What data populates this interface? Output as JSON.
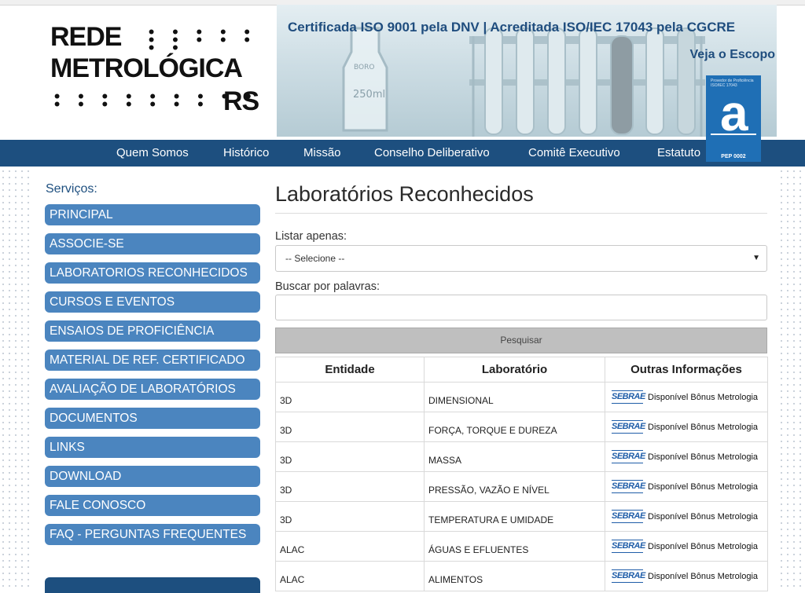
{
  "logo": {
    "line1": "REDE",
    "line2": "METROLÓGICA",
    "line3": "RS",
    "dots1": "• • • • • • • • • • • •",
    "dots2": "• • • • • • • • • • • • • • • •"
  },
  "banner": {
    "certification": "Certificada ISO 9001 pela DNV | Acreditada ISO/IEC 17043 pela CGCRE",
    "scope_link": "Veja o Escopo",
    "badge_small_text": "Provedor de Proficiência ISO/IEC 17043",
    "badge_letter": "a",
    "badge_code": "PEP 0002"
  },
  "nav": [
    "Quem Somos",
    "Histórico",
    "Missão",
    "Conselho Deliberativo",
    "Comitê Executivo",
    "Estatuto"
  ],
  "sidebar": {
    "title": "Serviços:",
    "items": [
      "PRINCIPAL",
      "ASSOCIE-SE",
      "LABORATORIOS RECONHECIDOS",
      "CURSOS E EVENTOS",
      "ENSAIOS DE PROFICIÊNCIA",
      "MATERIAL DE REF. CERTIFICADO",
      "AVALIAÇÃO DE LABORATÓRIOS",
      "DOCUMENTOS",
      "LINKS",
      "DOWNLOAD",
      "FALE CONOSCO",
      "FAQ - PERGUNTAS FREQUENTES"
    ]
  },
  "main": {
    "title": "Laboratórios Reconhecidos",
    "filter_label": "Listar apenas:",
    "filter_value": "-- Selecione --",
    "search_label": "Buscar por palavras:",
    "search_value": "",
    "search_button": "Pesquisar"
  },
  "table": {
    "headers": [
      "Entidade",
      "Laboratório",
      "Outras Informações"
    ],
    "sebrae_label": "SEBRAE",
    "rows": [
      {
        "entidade": "3D",
        "laboratorio": "DIMENSIONAL",
        "info": "Disponível Bônus Metrologia"
      },
      {
        "entidade": "3D",
        "laboratorio": "FORÇA, TORQUE E DUREZA",
        "info": "Disponível Bônus Metrologia"
      },
      {
        "entidade": "3D",
        "laboratorio": "MASSA",
        "info": "Disponível Bônus Metrologia"
      },
      {
        "entidade": "3D",
        "laboratorio": "PRESSÃO, VAZÃO E NÍVEL",
        "info": "Disponível Bônus Metrologia"
      },
      {
        "entidade": "3D",
        "laboratorio": "TEMPERATURA E UMIDADE",
        "info": "Disponível Bônus Metrologia"
      },
      {
        "entidade": "ALAC",
        "laboratorio": "ÁGUAS E EFLUENTES",
        "info": "Disponível Bônus Metrologia"
      },
      {
        "entidade": "ALAC",
        "laboratorio": "ALIMENTOS",
        "info": "Disponível Bônus Metrologia"
      }
    ]
  },
  "colors": {
    "navy": "#1d4f7f",
    "menu_button": "#4b85bf",
    "brand_blue": "#1f4d7e",
    "sebrae_blue": "#1f5da8"
  }
}
